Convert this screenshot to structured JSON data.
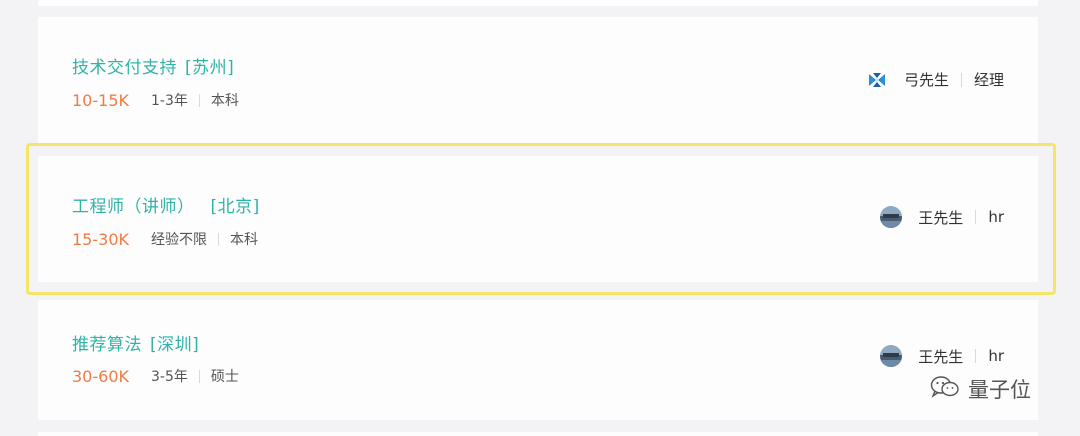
{
  "colors": {
    "title": "#2fb3a7",
    "salary": "#f07b44",
    "highlight": "#f4e46a"
  },
  "jobs": [
    {
      "title": "技术交付支持",
      "location": "[苏州]",
      "salary": "10-15K",
      "experience": "1-3年",
      "education": "本科",
      "recruiter_name": "弓先生",
      "recruiter_role": "经理",
      "avatar": "company-logo-icon"
    },
    {
      "title": "工程师（讲师）",
      "location": "[北京]",
      "salary": "15-30K",
      "experience": "经验不限",
      "education": "本科",
      "recruiter_name": "王先生",
      "recruiter_role": "hr",
      "avatar": "person-avatar",
      "highlighted": true
    },
    {
      "title": "推荐算法",
      "location": "[深圳]",
      "salary": "30-60K",
      "experience": "3-5年",
      "education": "硕士",
      "recruiter_name": "王先生",
      "recruiter_role": "hr",
      "avatar": "person-avatar"
    }
  ],
  "watermark": {
    "text": "量子位",
    "icon": "wechat-icon"
  }
}
